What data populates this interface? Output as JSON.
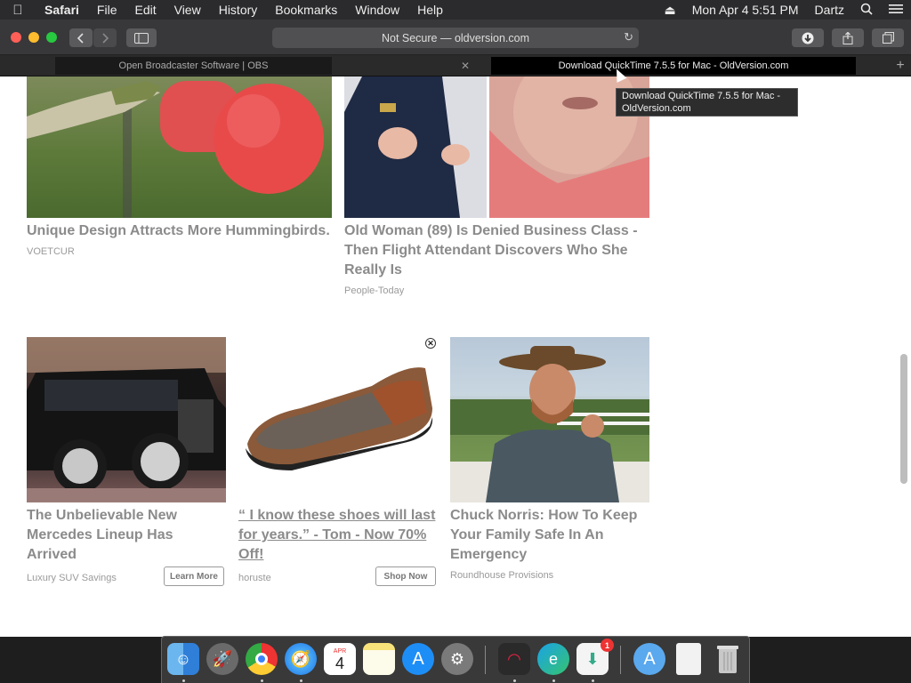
{
  "menubar": {
    "app": "Safari",
    "items": [
      "File",
      "Edit",
      "View",
      "History",
      "Bookmarks",
      "Window",
      "Help"
    ],
    "datetime": "Mon Apr 4  5:51 PM",
    "user": "Dartz"
  },
  "toolbar": {
    "address": "Not Secure — oldversion.com"
  },
  "tabs": [
    {
      "title": "Open Broadcaster Software | OBS"
    },
    {
      "title": "Download QuickTime 7.5.5 for Mac - OldVersion.com"
    }
  ],
  "tooltip": "Download QuickTime 7.5.5 for Mac -\nOldVersion.com",
  "cards": [
    {
      "title": "Unique Design Attracts More Hummingbirds.",
      "source": "VOETCUR"
    },
    {
      "title": "Old Woman (89) Is Denied Business Class - Then Flight Attendant Discovers Who She Really Is",
      "source": "People-Today"
    },
    {
      "title": "The Unbelievable New Mercedes Lineup Has Arrived",
      "source": "Luxury SUV Savings",
      "button": "Learn More"
    },
    {
      "title": "“ I know these shoes will last for years.” - Tom - Now 70% Off!",
      "source": "horuste",
      "button": "Shop Now"
    },
    {
      "title": "Chuck Norris: How To Keep Your Family Safe In An Emergency",
      "source": "Roundhouse Provisions"
    }
  ],
  "dock": {
    "calendar_month": "APR",
    "calendar_day": "4",
    "appstore_badge": "1"
  },
  "colors": {
    "menubar_bg": "#2b2b2d",
    "toolbar_bg": "#38383a",
    "close_light": "#fe5f57",
    "min_light": "#febc2e",
    "max_light": "#28c840",
    "ad_title": "#8b8b8b",
    "badge": "#e33333"
  }
}
